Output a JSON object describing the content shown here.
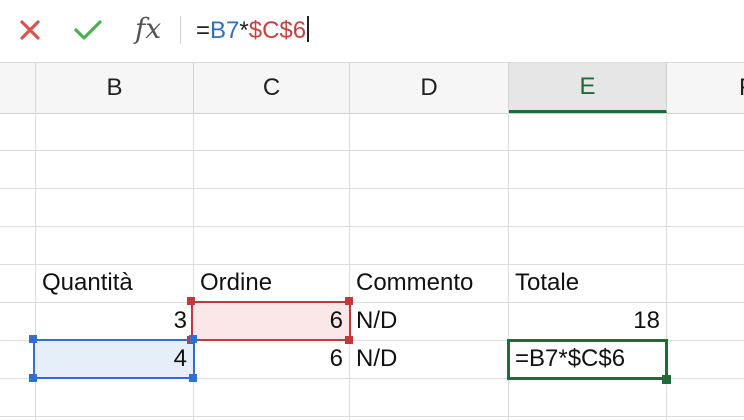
{
  "formula_bar": {
    "cancel_icon": "close-icon",
    "confirm_icon": "check-icon",
    "fx_label": "fx",
    "formula_prefix": "=",
    "formula_ref1": "B7",
    "formula_op": "*",
    "formula_ref2": "$C$6"
  },
  "columns": [
    {
      "letter": "B",
      "active": false
    },
    {
      "letter": "C",
      "active": false
    },
    {
      "letter": "D",
      "active": false
    },
    {
      "letter": "E",
      "active": true
    },
    {
      "letter": "F",
      "active": false
    }
  ],
  "rows": {
    "header": {
      "B": "Quantità",
      "C": "Ordine",
      "D": "Commento",
      "E": "Totale"
    },
    "row6": {
      "B": "3",
      "C": "6",
      "D": "N/D",
      "E": "18"
    },
    "row7": {
      "B": "4",
      "C": "6",
      "D": "N/D",
      "E": "=B7*$C$6"
    }
  },
  "colors": {
    "accent_green": "#1f6b3b",
    "ref_blue": "#2f6fcf",
    "ref_red": "#c03a3a"
  }
}
